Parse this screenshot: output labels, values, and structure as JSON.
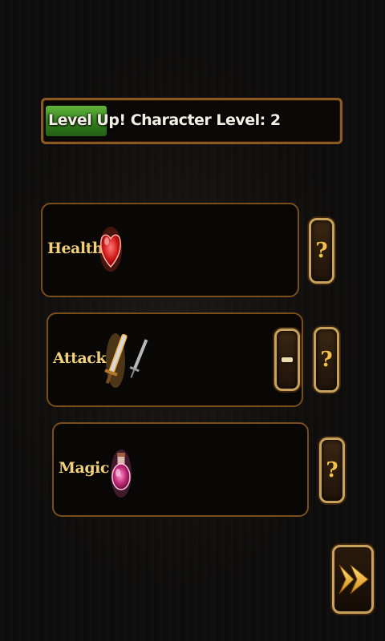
{
  "level": {
    "text": "Level Up! Character Level: 2",
    "progress": 0.21,
    "fill_color": "#4a9a2a"
  },
  "stats": [
    {
      "label": "Health",
      "icon": "heart-icon",
      "has_minus": false
    },
    {
      "label": "Attack",
      "icon": "sword-icon",
      "has_minus": true
    },
    {
      "label": "Magic",
      "icon": "potion-icon",
      "has_minus": false
    }
  ],
  "buttons": {
    "help_label": "?",
    "next_icon": "double-arrow-icon"
  },
  "colors": {
    "gold": "#f2c24a",
    "label": "#f2d07a",
    "frame": "#7a4e1c"
  }
}
